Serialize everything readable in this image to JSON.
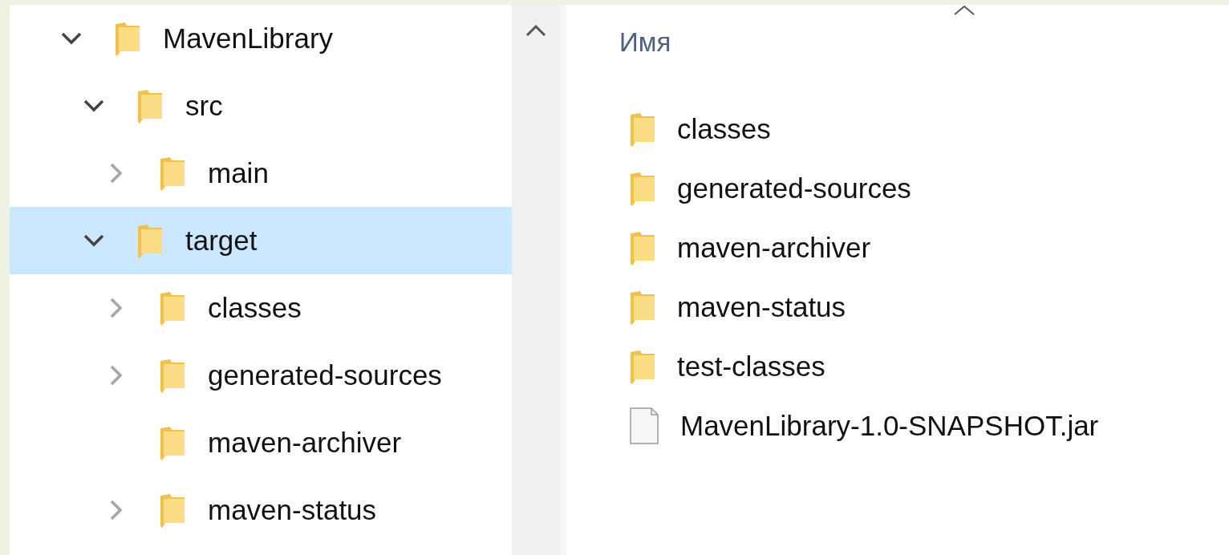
{
  "tree": [
    {
      "label": "MavenLibrary",
      "expandable": true,
      "expanded": true,
      "selected": false,
      "children": [
        {
          "label": "src",
          "expandable": true,
          "expanded": true,
          "selected": false,
          "children": [
            {
              "label": "main",
              "expandable": true,
              "expanded": false,
              "selected": false
            }
          ]
        },
        {
          "label": "target",
          "expandable": true,
          "expanded": true,
          "selected": true,
          "children": [
            {
              "label": "classes",
              "expandable": true,
              "expanded": false,
              "selected": false
            },
            {
              "label": "generated-sources",
              "expandable": true,
              "expanded": false,
              "selected": false
            },
            {
              "label": "maven-archiver",
              "expandable": false,
              "expanded": false,
              "selected": false
            },
            {
              "label": "maven-status",
              "expandable": true,
              "expanded": false,
              "selected": false
            }
          ]
        }
      ]
    }
  ],
  "file_list": {
    "column_header": "Имя",
    "items": [
      {
        "name": "classes",
        "kind": "folder"
      },
      {
        "name": "generated-sources",
        "kind": "folder"
      },
      {
        "name": "maven-archiver",
        "kind": "folder"
      },
      {
        "name": "maven-status",
        "kind": "folder"
      },
      {
        "name": "test-classes",
        "kind": "folder"
      },
      {
        "name": "MavenLibrary-1.0-SNAPSHOT.jar",
        "kind": "file"
      }
    ]
  }
}
